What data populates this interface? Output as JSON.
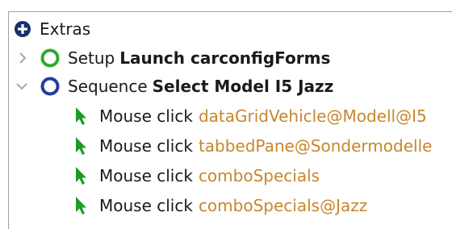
{
  "tree": {
    "root": {
      "label": "Extras",
      "icon": "add-circle-icon"
    },
    "setup": {
      "prefix": "Setup",
      "name": "Launch carconfigForms",
      "icon": "setup-ring-icon",
      "toggle": "expand-chevron-icon"
    },
    "sequence": {
      "prefix": "Sequence",
      "name": "Select Model I5 Jazz",
      "icon": "sequence-ring-icon",
      "toggle": "collapse-chevron-icon"
    },
    "steps": [
      {
        "action": "Mouse click",
        "target": "dataGridVehicle@Modell@I5",
        "icon": "cursor-arrow-icon"
      },
      {
        "action": "Mouse click",
        "target": "tabbedPane@Sondermodelle",
        "icon": "cursor-arrow-icon"
      },
      {
        "action": "Mouse click",
        "target": "comboSpecials",
        "icon": "cursor-arrow-icon"
      },
      {
        "action": "Mouse click",
        "target": "comboSpecials@Jazz",
        "icon": "cursor-arrow-icon"
      }
    ]
  },
  "colors": {
    "root_icon": "#1a2f6b",
    "setup_ring": "#2eaa2e",
    "sequence_ring": "#1f3f9f",
    "cursor": "#1d9a2a",
    "target_text": "#c8862b",
    "panel_border": "#9e9e9e"
  }
}
